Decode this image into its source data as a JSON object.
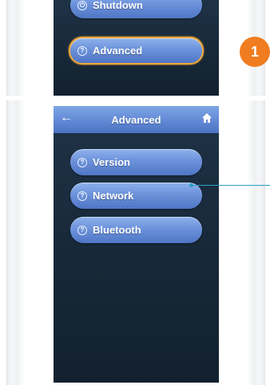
{
  "step_badge": "1",
  "top_menu": {
    "shutdown_label": "Shutdown",
    "advanced_label": "Advanced"
  },
  "advanced_screen": {
    "title": "Advanced",
    "back_icon": "back-arrow-icon",
    "home_icon": "home-icon",
    "items": [
      {
        "label": "Version",
        "icon": "info-icon"
      },
      {
        "label": "Network",
        "icon": "info-icon"
      },
      {
        "label": "Bluetooth",
        "icon": "info-icon"
      }
    ]
  },
  "colors": {
    "accent_orange": "#f07d1f",
    "selection_outline": "#f0a83a",
    "button_blue": "#6f95dd",
    "screen_dark": "#172838",
    "callout_line": "#2d9fc4"
  }
}
